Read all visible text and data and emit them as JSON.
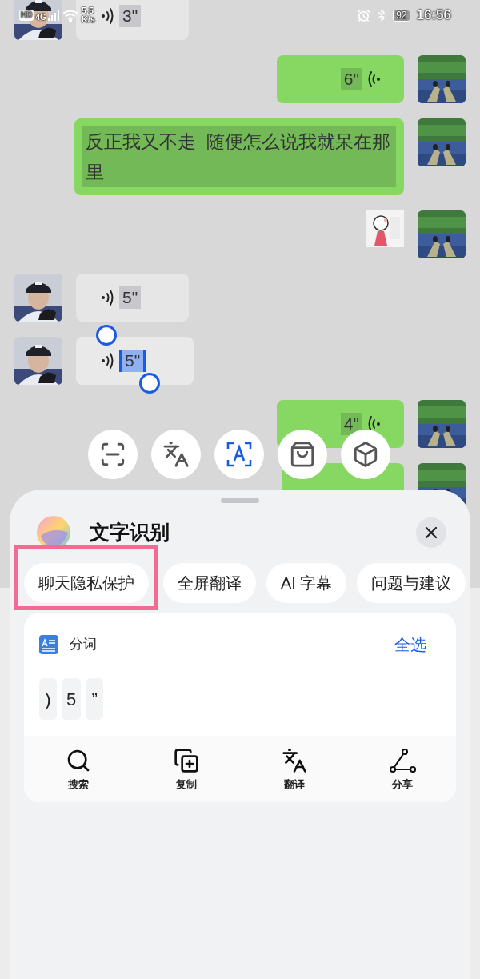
{
  "status_bar": {
    "hd": "HD",
    "network": "4G",
    "speed": [
      "5.5",
      "K/s"
    ],
    "battery": "92",
    "time": "16:56"
  },
  "messages": [
    {
      "outgoing": false,
      "kind": "voice",
      "duration": "3\"",
      "selected": false
    },
    {
      "outgoing": true,
      "kind": "voice",
      "duration": "6\"",
      "selected": false
    },
    {
      "outgoing": true,
      "kind": "text",
      "text": "反正我又不走  随便怎么说我就呆在那里",
      "selected": false
    },
    {
      "outgoing": true,
      "kind": "sticker",
      "selected": false
    },
    {
      "outgoing": false,
      "kind": "voice",
      "duration": "5\"",
      "selected": false
    },
    {
      "outgoing": false,
      "kind": "voice",
      "duration": "5\"",
      "selected": true
    },
    {
      "outgoing": true,
      "kind": "voice",
      "duration": "4\"",
      "selected": false
    },
    {
      "outgoing": true,
      "kind": "voice",
      "selected": false
    }
  ],
  "tools": [
    {
      "selected": false
    },
    {
      "selected": false
    },
    {
      "selected": true
    },
    {
      "selected": false
    },
    {
      "selected": false
    }
  ],
  "sheet": {
    "title": "文字识别",
    "chips": [
      {
        "label": "聊天隐私保护",
        "highlighted": true
      },
      {
        "label": "全屏翻译",
        "highlighted": false
      },
      {
        "label": "AI 字幕",
        "highlighted": false
      },
      {
        "label": "问题与建议",
        "highlighted": false
      }
    ],
    "card": {
      "section": "分词",
      "select_all": "全选",
      "tokens": [
        ")",
        "5",
        "”"
      ],
      "actions": [
        {
          "label": "搜索"
        },
        {
          "label": "复制"
        },
        {
          "label": "翻译"
        },
        {
          "label": "分享"
        }
      ]
    }
  }
}
